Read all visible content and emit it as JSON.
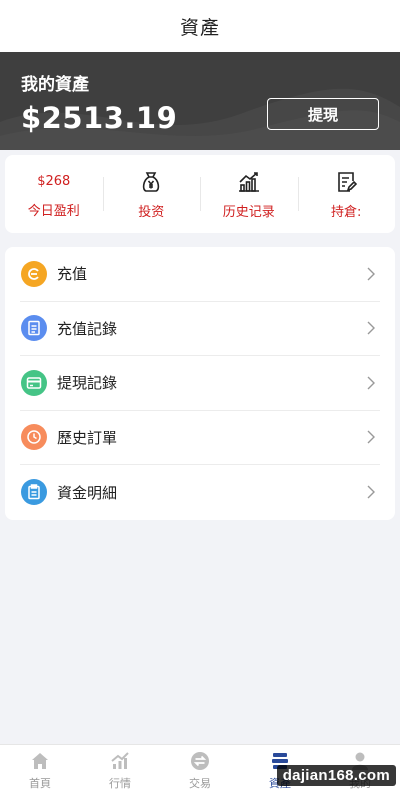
{
  "header": {
    "title": "資產"
  },
  "banner": {
    "label": "我的資產",
    "amount": "$2513.19",
    "withdraw_label": "提現"
  },
  "stats": [
    {
      "value": "$268",
      "label": "今日盈利"
    },
    {
      "label": "投资",
      "icon": "money-bag-icon"
    },
    {
      "label": "历史记录",
      "icon": "bar-chart-icon"
    },
    {
      "label": "持倉:",
      "icon": "edit-note-icon"
    }
  ],
  "menu": [
    {
      "label": "充值",
      "icon": "recharge-icon",
      "color": "#f5a623"
    },
    {
      "label": "充值記錄",
      "icon": "document-icon",
      "color": "#5b8def"
    },
    {
      "label": "提現記錄",
      "icon": "card-icon",
      "color": "#45c486"
    },
    {
      "label": "歷史訂單",
      "icon": "clock-icon",
      "color": "#f78c5c"
    },
    {
      "label": "資金明細",
      "icon": "clipboard-icon",
      "color": "#3a9ae0"
    }
  ],
  "tabbar": [
    {
      "label": "首頁",
      "icon": "home-icon"
    },
    {
      "label": "行情",
      "icon": "trend-icon"
    },
    {
      "label": "交易",
      "icon": "exchange-icon"
    },
    {
      "label": "資產",
      "icon": "wallet-icon",
      "active": true
    },
    {
      "label": "我的",
      "icon": "user-icon"
    }
  ],
  "colors": {
    "accent_red": "#d02020",
    "banner_bg": "#3f3f3f",
    "active_tab": "#2a4a9a"
  },
  "watermark": "dajian168.com"
}
